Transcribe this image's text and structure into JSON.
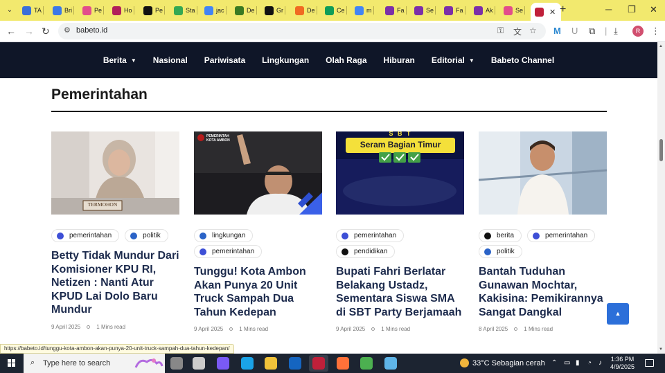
{
  "browser": {
    "tabs": [
      {
        "label": "TA",
        "color": "#3a6fd8"
      },
      {
        "label": "Bri",
        "color": "#3b78e7"
      },
      {
        "label": "Pe",
        "color": "#e24d8b"
      },
      {
        "label": "Ho",
        "color": "#b0205a"
      },
      {
        "label": "Pe",
        "color": "#111111"
      },
      {
        "label": "Sta",
        "color": "#34a853"
      },
      {
        "label": "jac",
        "color": "#4285f4"
      },
      {
        "label": "De",
        "color": "#3a7a22"
      },
      {
        "label": "Gr",
        "color": "#111111"
      },
      {
        "label": "De",
        "color": "#f06a22"
      },
      {
        "label": "Ce",
        "color": "#0f9d58"
      },
      {
        "label": "m",
        "color": "#4285f4"
      },
      {
        "label": "Fa",
        "color": "#7b2fa8"
      },
      {
        "label": "Se",
        "color": "#7b2fa8"
      },
      {
        "label": "Fa",
        "color": "#7b2fa8"
      },
      {
        "label": "Ak",
        "color": "#7b2fa8"
      },
      {
        "label": "Se",
        "color": "#e24d8b"
      }
    ],
    "active_tab_color": "#c0203a",
    "url": "babeto.id"
  },
  "site": {
    "nav": [
      {
        "label": "Berita",
        "dropdown": true
      },
      {
        "label": "Nasional",
        "dropdown": false
      },
      {
        "label": "Pariwisata",
        "dropdown": false
      },
      {
        "label": "Lingkungan",
        "dropdown": false
      },
      {
        "label": "Olah Raga",
        "dropdown": false
      },
      {
        "label": "Hiburan",
        "dropdown": false
      },
      {
        "label": "Editorial",
        "dropdown": true
      },
      {
        "label": "Babeto Channel",
        "dropdown": false
      }
    ],
    "section_title": "Pemerintahan",
    "articles": [
      {
        "tags": [
          {
            "label": "pemerintahan",
            "color": "#3d4fd6"
          },
          {
            "label": "politik",
            "color": "#2b63c7"
          }
        ],
        "title": "Betty Tidak Mundur Dari Komisioner KPU RI, Netizen : Nanti Atur KPUD Lai Dolo Baru Mundur",
        "date": "9 April 2025",
        "read": "1 Mins read",
        "image_caption": "TERMOHON"
      },
      {
        "tags": [
          {
            "label": "lingkungan",
            "color": "#2b63c7"
          },
          {
            "label": "pemerintahan",
            "color": "#3d4fd6"
          }
        ],
        "title": "Tunggu! Kota Ambon Akan Punya 20 Unit Truck Sampah Dua Tahun Kedepan",
        "date": "9 April 2025",
        "read": "1 Mins read",
        "image_caption": "PEMERINTAH KOTA AMBON"
      },
      {
        "tags": [
          {
            "label": "pemerintahan",
            "color": "#3d4fd6"
          },
          {
            "label": "pendidikan",
            "color": "#111111"
          }
        ],
        "title": "Bupati Fahri Berlatar Belakang Ustadz, Sementara Siswa SMA di SBT Party Berjamaah",
        "date": "9 April 2025",
        "read": "1 Mins read",
        "image_caption": "S B T",
        "image_banner": "Seram Bagian Timur"
      },
      {
        "tags": [
          {
            "label": "berita",
            "color": "#111111"
          },
          {
            "label": "pemerintahan",
            "color": "#3d4fd6"
          },
          {
            "label": "politik",
            "color": "#2b63c7"
          }
        ],
        "title": "Bantah Tuduhan Gunawan Mochtar, Kakisina: Pemikirannya Sangat Dangkal",
        "date": "8 April 2025",
        "read": "1 Mins read"
      }
    ]
  },
  "status_link": "https://babeto.id/tunggu-kota-ambon-akan-punya-20-unit-truck-sampah-dua-tahun-kedepan/",
  "taskbar": {
    "search_placeholder": "Type here to search",
    "weather": "33°C  Sebagian cerah",
    "time": "1:36 PM",
    "date": "4/9/2025",
    "apps": [
      "#888888",
      "#cccccc",
      "#7a5af5",
      "#1aa3e8",
      "#f0c23a",
      "#1565c0",
      "#c0203a",
      "#ff7139",
      "#4cb050",
      "#5fb5e8"
    ]
  }
}
